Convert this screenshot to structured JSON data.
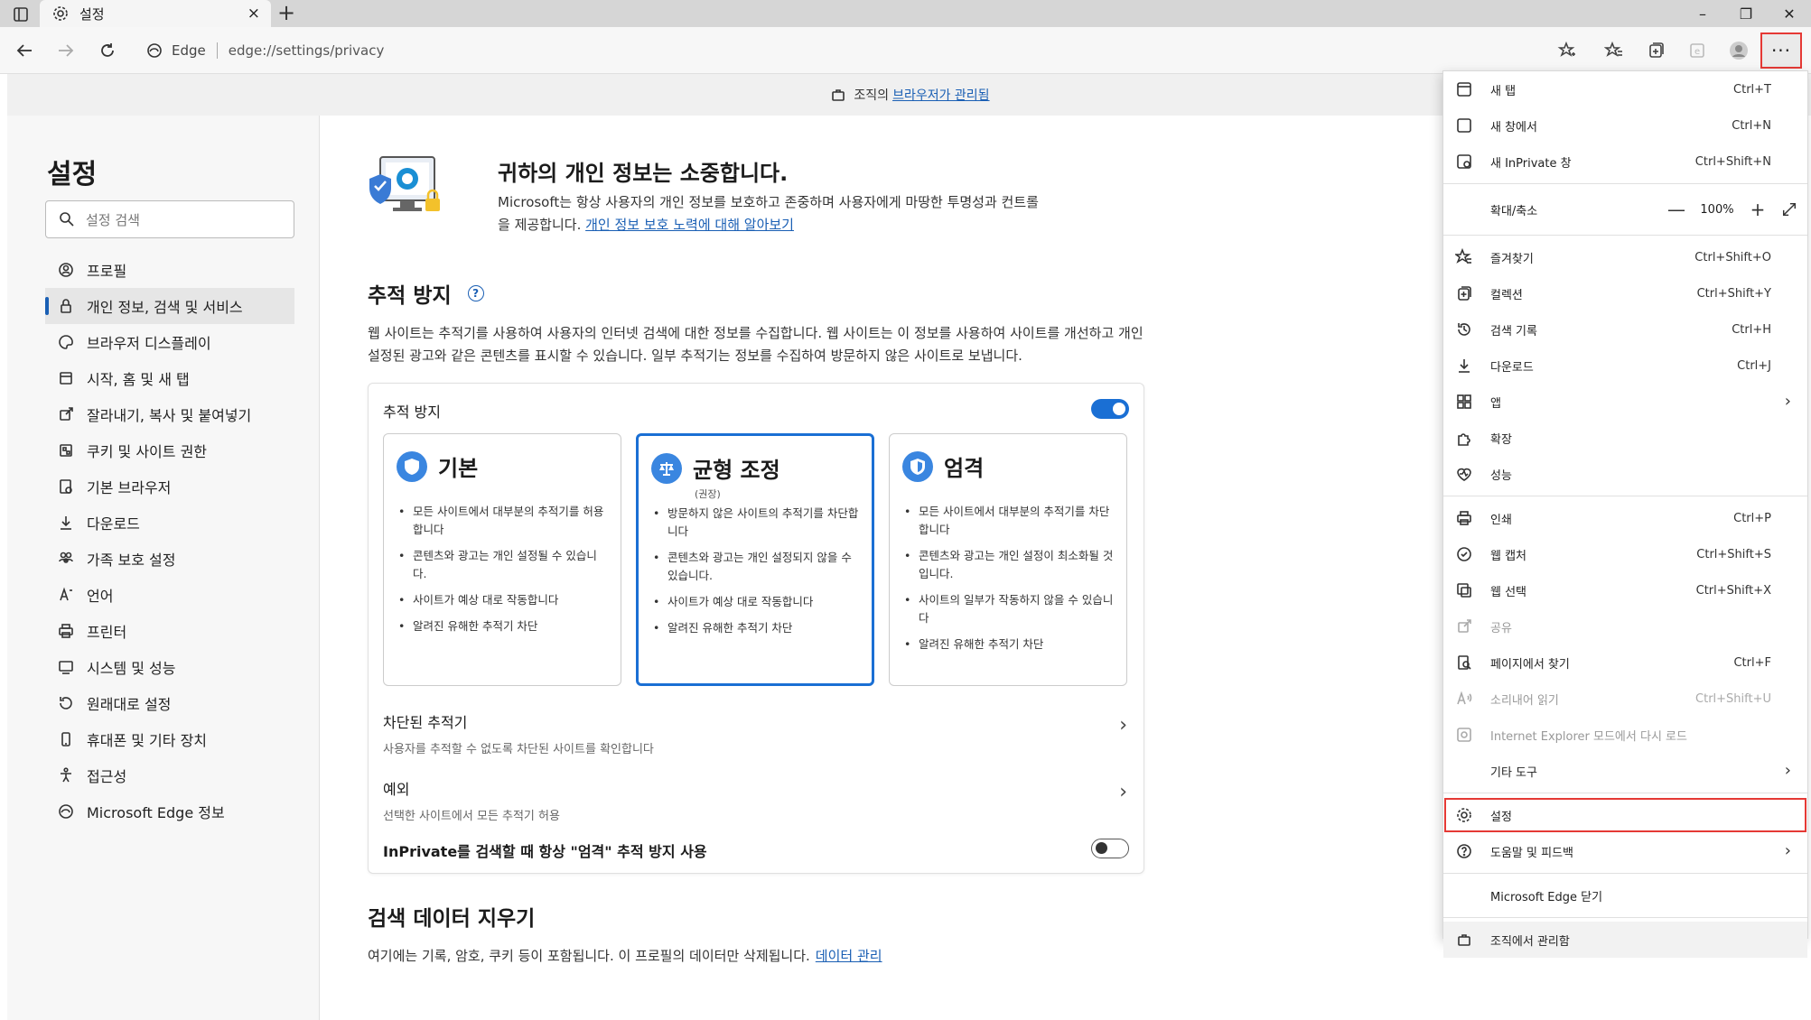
{
  "tab": {
    "title": "설정",
    "close": "×",
    "new": "+"
  },
  "window": {
    "minimize": "–",
    "restore": "❐",
    "close": "✕"
  },
  "address": {
    "edge_label": "Edge",
    "url": "edge://settings/privacy"
  },
  "toolbar": {
    "more": "···"
  },
  "banner": {
    "text": "조직의",
    "link": "브라우저가 관리됨"
  },
  "sidebar": {
    "title": "설정",
    "search_placeholder": "설정 검색",
    "items": [
      {
        "label": "프로필",
        "icon": "profile-icon"
      },
      {
        "label": "개인 정보, 검색 및 서비스",
        "icon": "lock-icon",
        "active": true
      },
      {
        "label": "브라우저 디스플레이",
        "icon": "palette-icon"
      },
      {
        "label": "시작, 홈 및 새 탭",
        "icon": "home-icon"
      },
      {
        "label": "잘라내기, 복사 및 붙여넣기",
        "icon": "share-icon"
      },
      {
        "label": "쿠키 및 사이트 권한",
        "icon": "cookie-icon"
      },
      {
        "label": "기본 브라우저",
        "icon": "browser-icon"
      },
      {
        "label": "다운로드",
        "icon": "download-icon"
      },
      {
        "label": "가족 보호 설정",
        "icon": "family-icon"
      },
      {
        "label": "언어",
        "icon": "language-icon"
      },
      {
        "label": "프린터",
        "icon": "printer-icon"
      },
      {
        "label": "시스템 및 성능",
        "icon": "system-icon"
      },
      {
        "label": "원래대로 설정",
        "icon": "reset-icon"
      },
      {
        "label": "휴대폰 및 기타 장치",
        "icon": "phone-icon"
      },
      {
        "label": "접근성",
        "icon": "accessibility-icon"
      },
      {
        "label": "Microsoft Edge 정보",
        "icon": "edge-icon"
      }
    ]
  },
  "main": {
    "hero_title": "귀하의 개인 정보는 소중합니다.",
    "hero_desc": "Microsoft는 항상 사용자의 개인 정보를 보호하고 존중하며 사용자에게 마땅한 투명성과 컨트롤을 제공합니다.",
    "hero_link": "개인 정보 보호 노력에 대해 알아보기",
    "tp_title": "추적 방지",
    "tp_help": "?",
    "tp_desc": "웹 사이트는 추적기를 사용하여 사용자의 인터넷 검색에 대한 정보를 수집합니다. 웹 사이트는 이 정보를 사용하여 사이트를 개선하고 개인 설정된 광고와 같은 콘텐츠를 표시할 수 있습니다. 일부 추적기는 정보를 수집하여 방문하지 않은 사이트로 보냅니다.",
    "card_head": "추적 방지",
    "tracking_on": true,
    "options": [
      {
        "name": "기본",
        "sub": "",
        "bullets": [
          "모든 사이트에서 대부분의 추적기를 허용합니다",
          "콘텐츠와 광고는 개인 설정될 수 있습니다.",
          "사이트가 예상 대로 작동합니다",
          "알려진 유해한 추적기 차단"
        ]
      },
      {
        "name": "균형 조정",
        "sub": "(권장)",
        "bullets": [
          "방문하지 않은 사이트의 추적기를 차단합니다",
          "콘텐츠와 광고는 개인 설정되지 않을 수 있습니다.",
          "사이트가 예상 대로 작동합니다",
          "알려진 유해한 추적기 차단"
        ]
      },
      {
        "name": "엄격",
        "sub": "",
        "bullets": [
          "모든 사이트에서 대부분의 추적기를 차단합니다",
          "콘텐츠와 광고는 개인 설정이 최소화될 것입니다.",
          "사이트의 일부가 작동하지 않을 수 있습니다",
          "알려진 유해한 추적기 차단"
        ]
      }
    ],
    "blocked_title": "차단된 추적기",
    "blocked_sub": "사용자를 추적할 수 없도록 차단된 사이트를 확인합니다",
    "exceptions_title": "예외",
    "exceptions_sub": "선택한 사이트에서 모든 추적기 허용",
    "chevron": "›",
    "inprivate_label": "InPrivate를 검색할 때 항상 \"엄격\" 추적 방지 사용",
    "inprivate_on": false,
    "clear_title": "검색 데이터 지우기",
    "clear_desc": "여기에는 기록, 암호, 쿠키 등이 포함됩니다. 이 프로필의 데이터만 삭제됩니다.",
    "clear_link": "데이터 관리"
  },
  "menu": {
    "items": [
      {
        "label": "새 탭",
        "shortcut": "Ctrl+T",
        "icon": "new-tab-icon"
      },
      {
        "label": "새 창에서",
        "shortcut": "Ctrl+N",
        "icon": "new-window-icon"
      },
      {
        "label": "새 InPrivate 창",
        "shortcut": "Ctrl+Shift+N",
        "icon": "inprivate-icon"
      },
      {
        "label": "즐겨찾기",
        "shortcut": "Ctrl+Shift+O",
        "icon": "favorites-icon"
      },
      {
        "label": "컬렉션",
        "shortcut": "Ctrl+Shift+Y",
        "icon": "collections-icon"
      },
      {
        "label": "검색 기록",
        "shortcut": "Ctrl+H",
        "icon": "history-icon"
      },
      {
        "label": "다운로드",
        "shortcut": "Ctrl+J",
        "icon": "download-icon"
      },
      {
        "label": "앱",
        "shortcut": "",
        "icon": "apps-icon"
      },
      {
        "label": "확장",
        "shortcut": "",
        "icon": "extensions-icon"
      },
      {
        "label": "성능",
        "shortcut": "",
        "icon": "performance-icon"
      },
      {
        "label": "인쇄",
        "shortcut": "Ctrl+P",
        "icon": "print-icon"
      },
      {
        "label": "웹 캡처",
        "shortcut": "Ctrl+Shift+S",
        "icon": "web-capture-icon"
      },
      {
        "label": "웹 선택",
        "shortcut": "Ctrl+Shift+X",
        "icon": "web-select-icon"
      },
      {
        "label": "공유",
        "shortcut": "",
        "icon": "share-icon"
      },
      {
        "label": "페이지에서 찾기",
        "shortcut": "Ctrl+F",
        "icon": "find-icon"
      },
      {
        "label": "소리내어 읽기",
        "shortcut": "Ctrl+Shift+U",
        "icon": "read-aloud-icon"
      },
      {
        "label": "Internet Explorer 모드에서 다시 로드",
        "shortcut": "",
        "icon": "ie-mode-icon"
      },
      {
        "label": "기타 도구",
        "shortcut": ""
      },
      {
        "label": "설정",
        "shortcut": "",
        "icon": "settings-icon"
      },
      {
        "label": "도움말 및 피드백",
        "shortcut": "",
        "icon": "help-icon"
      },
      {
        "label": "Microsoft Edge 닫기",
        "shortcut": ""
      },
      {
        "label": "조직에서 관리함",
        "shortcut": "",
        "icon": "briefcase-icon"
      }
    ],
    "zoom_label": "확대/축소",
    "zoom_value": "100%",
    "zoom_minus": "—",
    "zoom_plus": "+",
    "arrow": "›"
  },
  "colors": {
    "accent": "#1a6fd4",
    "highlight": "#e53935"
  }
}
